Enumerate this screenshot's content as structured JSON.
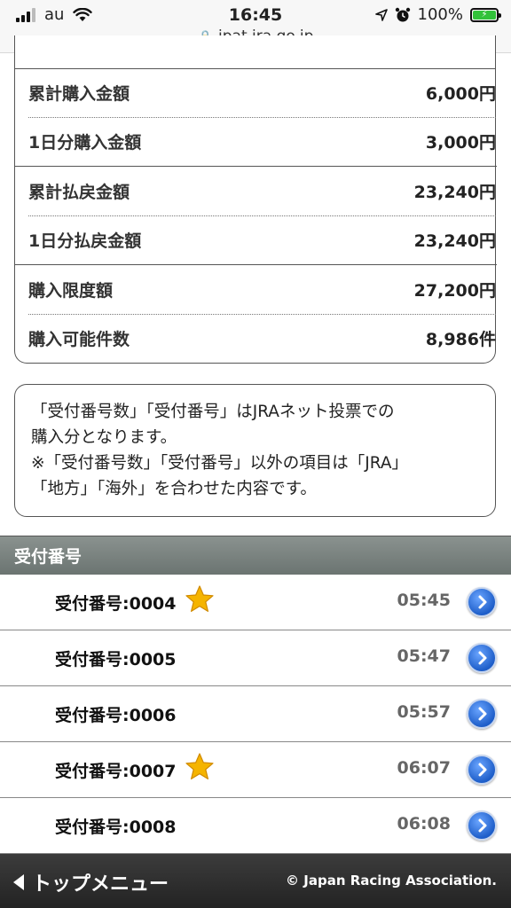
{
  "status_bar": {
    "carrier": "au",
    "time": "16:45",
    "battery": "100%",
    "url": "ipat.jra.go.jp"
  },
  "summary": {
    "rows": [
      {
        "label": "累計購入金額",
        "value": "6,000円"
      },
      {
        "label": "1日分購入金額",
        "value": "3,000円"
      },
      {
        "label": "累計払戻金額",
        "value": "23,240円"
      },
      {
        "label": "1日分払戻金額",
        "value": "23,240円"
      },
      {
        "label": "購入限度額",
        "value": "27,200円"
      },
      {
        "label": "購入可能件数",
        "value": "8,986件"
      }
    ]
  },
  "note": {
    "line1": "「受付番号数」「受付番号」はJRAネット投票での",
    "line2": "購入分となります。",
    "line3": "※「受付番号数」「受付番号」以外の項目は「JRA」",
    "line4": "「地方」「海外」を合わせた内容です。"
  },
  "section_title": "受付番号",
  "receipts": [
    {
      "label": "受付番号:0004",
      "time": "05:45",
      "starred": true
    },
    {
      "label": "受付番号:0005",
      "time": "05:47",
      "starred": false
    },
    {
      "label": "受付番号:0006",
      "time": "05:57",
      "starred": false
    },
    {
      "label": "受付番号:0007",
      "time": "06:07",
      "starred": true
    },
    {
      "label": "受付番号:0008",
      "time": "06:08",
      "starred": false
    }
  ],
  "footer": {
    "top_menu": "トップメニュー",
    "copyright": "© Japan Racing Association."
  },
  "colors": {
    "battery": "#31c23a",
    "star": "#f5b400",
    "button": "#2f6fd8",
    "footer": "#2b2b2b"
  }
}
